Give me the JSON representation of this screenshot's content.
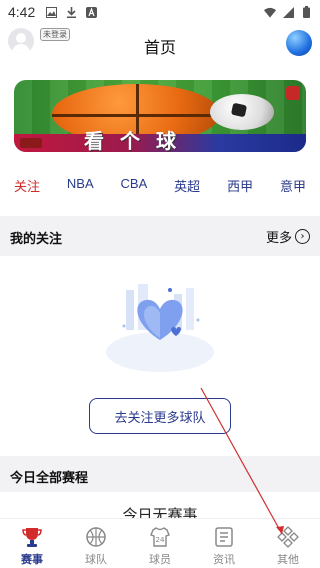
{
  "status_bar": {
    "time": "4:42",
    "left_icons": [
      "image-icon",
      "download-icon",
      "a-icon"
    ],
    "right_icons": [
      "wifi-icon",
      "signal-icon",
      "battery-icon"
    ]
  },
  "header": {
    "login_badge": "未登录",
    "title": "首页"
  },
  "banner": {
    "text": "看个球"
  },
  "tabs": [
    {
      "label": "关注",
      "active": true
    },
    {
      "label": "NBA",
      "active": false
    },
    {
      "label": "CBA",
      "active": false
    },
    {
      "label": "英超",
      "active": false
    },
    {
      "label": "西甲",
      "active": false
    },
    {
      "label": "意甲",
      "active": false
    }
  ],
  "my_follow": {
    "title": "我的关注",
    "more_label": "更多",
    "follow_button": "去关注更多球队"
  },
  "schedule": {
    "title": "今日全部赛程",
    "empty_text": "今日无赛事"
  },
  "bottom_nav": [
    {
      "label": "赛事",
      "icon": "trophy-icon",
      "active": true
    },
    {
      "label": "球队",
      "icon": "ball-icon",
      "active": false
    },
    {
      "label": "球员",
      "icon": "jersey-icon",
      "active": false
    },
    {
      "label": "资讯",
      "icon": "news-icon",
      "active": false
    },
    {
      "label": "其他",
      "icon": "diamonds-icon",
      "active": false
    }
  ],
  "colors": {
    "accent": "#2a3a8c",
    "active_tab": "#d22b2b",
    "annotation_arrow": "#d32f2f"
  }
}
